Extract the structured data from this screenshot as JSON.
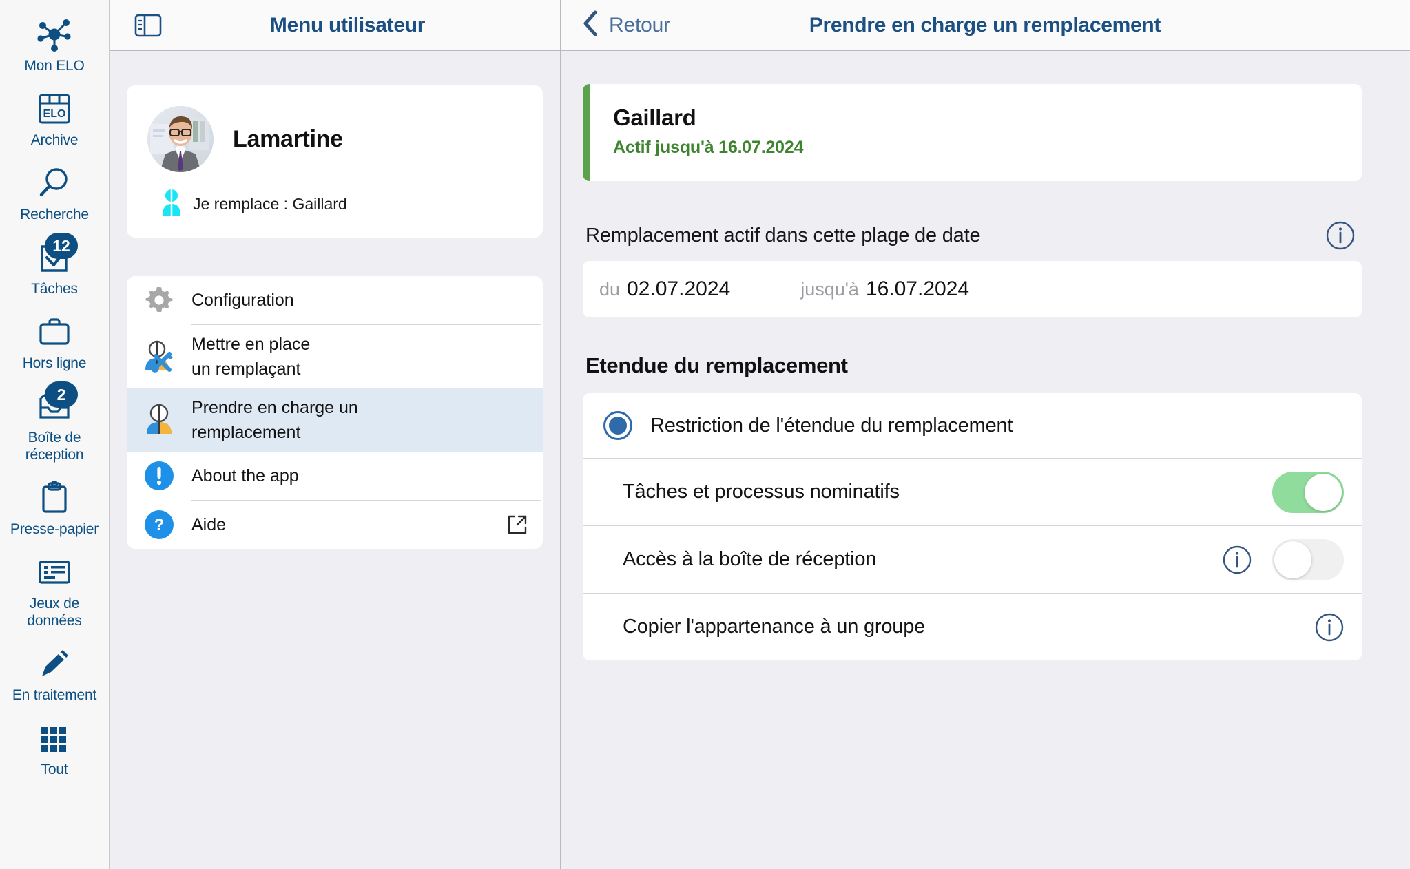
{
  "sidebar": {
    "items": [
      {
        "label": "Mon ELO",
        "icon": "network-hub-icon",
        "badge": null
      },
      {
        "label": "Archive",
        "icon": "elo-archive-icon",
        "badge": null
      },
      {
        "label": "Recherche",
        "icon": "search-icon",
        "badge": null
      },
      {
        "label": "Tâches",
        "icon": "checkbox-tasks-icon",
        "badge": "12"
      },
      {
        "label": "Hors ligne",
        "icon": "briefcase-icon",
        "badge": null
      },
      {
        "label": "Boîte de\nréception",
        "icon": "inbox-tray-icon",
        "badge": "2"
      },
      {
        "label": "Presse-papier",
        "icon": "clipboard-icon",
        "badge": null
      },
      {
        "label": "Jeux de\ndonnées",
        "icon": "dataset-card-icon",
        "badge": null
      },
      {
        "label": "En traitement",
        "icon": "pencil-icon",
        "badge": null
      },
      {
        "label": "Tout",
        "icon": "grid-all-icon",
        "badge": null
      }
    ]
  },
  "middle_panel": {
    "header": {
      "panel_toggle_icon": "sidebar-panel-icon",
      "title": "Menu utilisateur"
    },
    "profile": {
      "avatar": "user-photo-avatar",
      "name": "Lamartine",
      "substitute_icon": "person-substitute-icon",
      "substitute_text": "Je remplace : Gaillard"
    },
    "menu": [
      {
        "label": "Configuration",
        "icon": "gear-icon",
        "selected": false,
        "external": false,
        "separator_after": true
      },
      {
        "label": "Mettre en place\nun remplaçant",
        "icon": "person-tools-icon",
        "selected": false,
        "external": false,
        "separator_after": false
      },
      {
        "label": "Prendre en charge un\nremplacement",
        "icon": "person-two-tone-icon",
        "selected": true,
        "external": false,
        "separator_after": false
      },
      {
        "label": "About the app",
        "icon": "info-exclamation-icon",
        "selected": false,
        "external": false,
        "separator_after": true
      },
      {
        "label": "Aide",
        "icon": "question-help-icon",
        "selected": false,
        "external": true,
        "separator_after": false
      }
    ]
  },
  "right_panel": {
    "header": {
      "back_icon": "chevron-left-icon",
      "back_label": "Retour",
      "title": "Prendre en charge un remplacement"
    },
    "status": {
      "name": "Gaillard",
      "active_until": "Actif jusqu'à 16.07.2024",
      "accent_color": "#5ba34a"
    },
    "date_range": {
      "section_label": "Remplacement actif dans cette plage de date",
      "info_icon": "info-circle-icon",
      "from_prefix": "du",
      "from_value": "02.07.2024",
      "to_prefix": "jusqu'à",
      "to_value": "16.07.2024"
    },
    "scope": {
      "title": "Etendue du remplacement",
      "radio_label": "Restriction de l'étendue du remplacement",
      "radio_selected": true,
      "rows": [
        {
          "label": "Tâches et processus nominatifs",
          "has_info": false,
          "has_toggle": true,
          "toggle_on": true
        },
        {
          "label": "Accès à la boîte de réception",
          "has_info": true,
          "has_toggle": true,
          "toggle_on": false
        },
        {
          "label": "Copier l'appartenance à un groupe",
          "has_info": true,
          "has_toggle": false,
          "toggle_on": false
        }
      ]
    }
  },
  "colors": {
    "brand_blue": "#0d4f82",
    "title_blue": "#1c4f82",
    "green_accent": "#5ba34a",
    "toggle_on": "#8fdc9c",
    "selected_row": "#dee9f4",
    "panel_bg": "#eeeef3"
  }
}
